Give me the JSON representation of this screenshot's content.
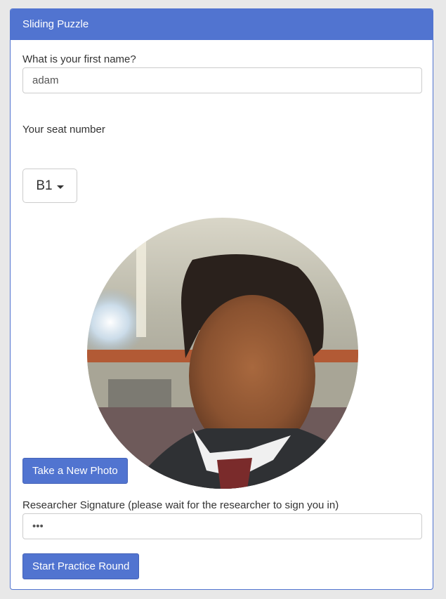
{
  "header": {
    "title": "Sliding Puzzle"
  },
  "name_field": {
    "label": "What is your first name?",
    "value": "adam"
  },
  "seat": {
    "label": "Your seat number",
    "selected": "B1"
  },
  "photo": {
    "retake_label": "Take a New Photo"
  },
  "signature": {
    "label": "Researcher Signature (please wait for the researcher to sign you in)",
    "value": "•••"
  },
  "start_button": {
    "label": "Start Practice Round"
  },
  "colors": {
    "accent": "#5174d0",
    "background": "#e8e8e8"
  }
}
